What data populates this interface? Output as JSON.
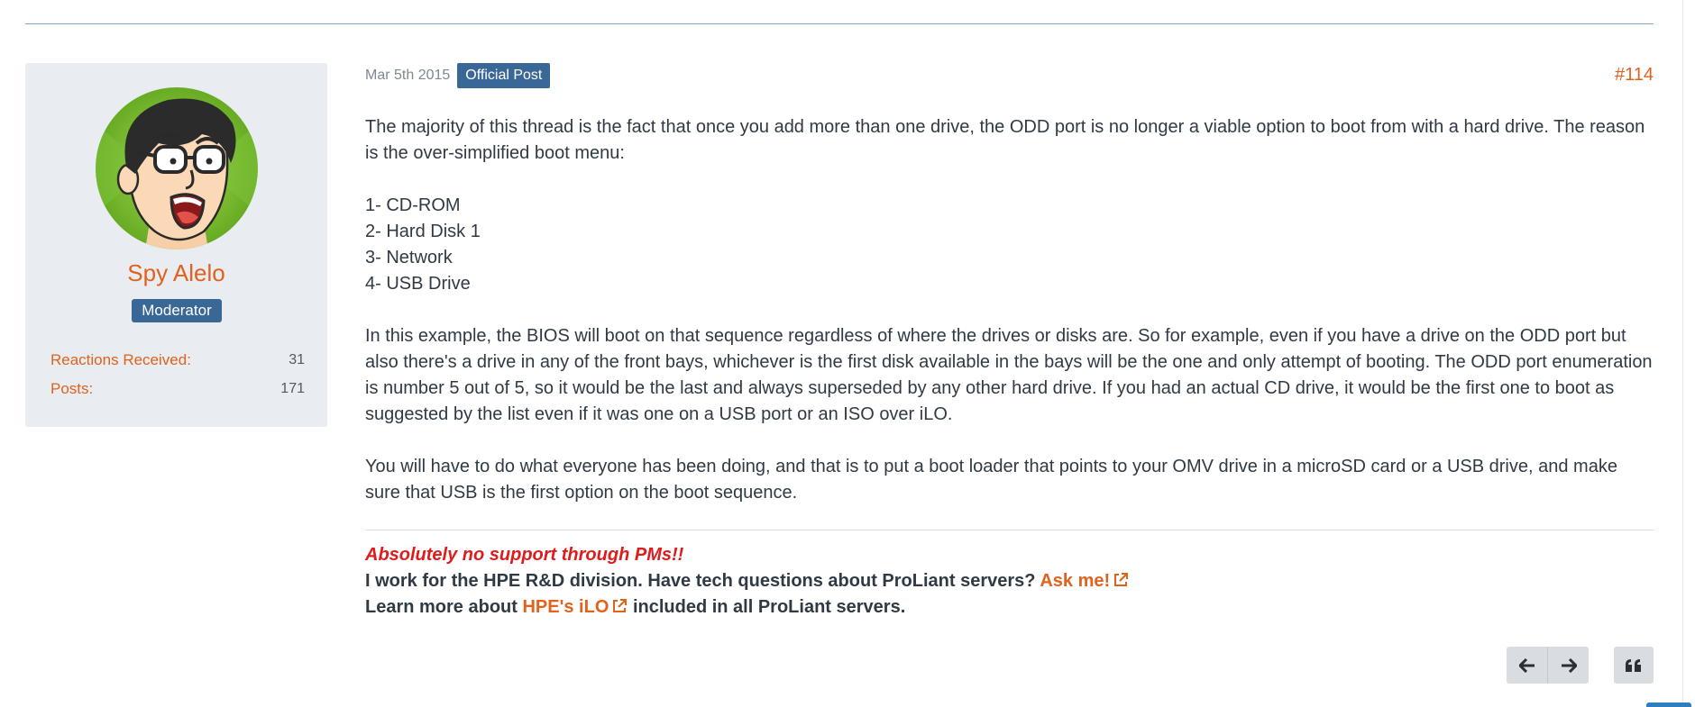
{
  "author": {
    "name": "Spy Alelo",
    "role": "Moderator",
    "avatar_icon": "cartoon-face-avatar",
    "stats": [
      {
        "label": "Reactions Received:",
        "value": "31"
      },
      {
        "label": "Posts:",
        "value": "171"
      }
    ]
  },
  "post": {
    "date": "Mar 5th 2015",
    "badge": "Official Post",
    "number": "#114",
    "paragraphs": [
      "The majority of this thread is the fact that once you add more than one drive, the ODD port is no longer a viable option to boot from with a hard drive. The reason is the over-simplified boot menu:",
      "In this example, the BIOS will boot on that sequence regardless of where the drives or disks are. So for example, even if you have a drive on the ODD port but also there's a drive in any of the front bays, whichever is the first disk available in the bays will be the one and only attempt of booting. The ODD port enumeration is number 5 out of 5, so it would be the last and always superseded by any other hard drive. If you had an actual CD drive, it would be the first one to boot as suggested by the list even if it was one on a USB port or an ISO over iLO.",
      "You will have to do what everyone has been doing, and that is to put a boot loader that points to your OMV drive in a microSD card or a USB drive, and make sure that USB is the first option on the boot sequence."
    ],
    "boot_list": [
      "1- CD-ROM",
      "2- Hard Disk 1",
      "3- Network",
      "4- USB Drive"
    ]
  },
  "signature": {
    "warning": "Absolutely no support through PMs!!",
    "line2_prefix": "I work for the HPE R&D division. Have tech questions about ProLiant servers?",
    "line2_link": "Ask me!",
    "line3_prefix": "Learn more about",
    "line3_link": "HPE's iLO",
    "line3_suffix": "included in all ProLiant servers."
  },
  "actions": {
    "prev_icon": "arrow-left-icon",
    "next_icon": "arrow-right-icon",
    "quote_icon": "quote-icon"
  },
  "colors": {
    "accent": "#e0621d",
    "badge": "#3a6896",
    "warning": "#e01b1b",
    "sidebar_bg": "#e9ecf0"
  }
}
